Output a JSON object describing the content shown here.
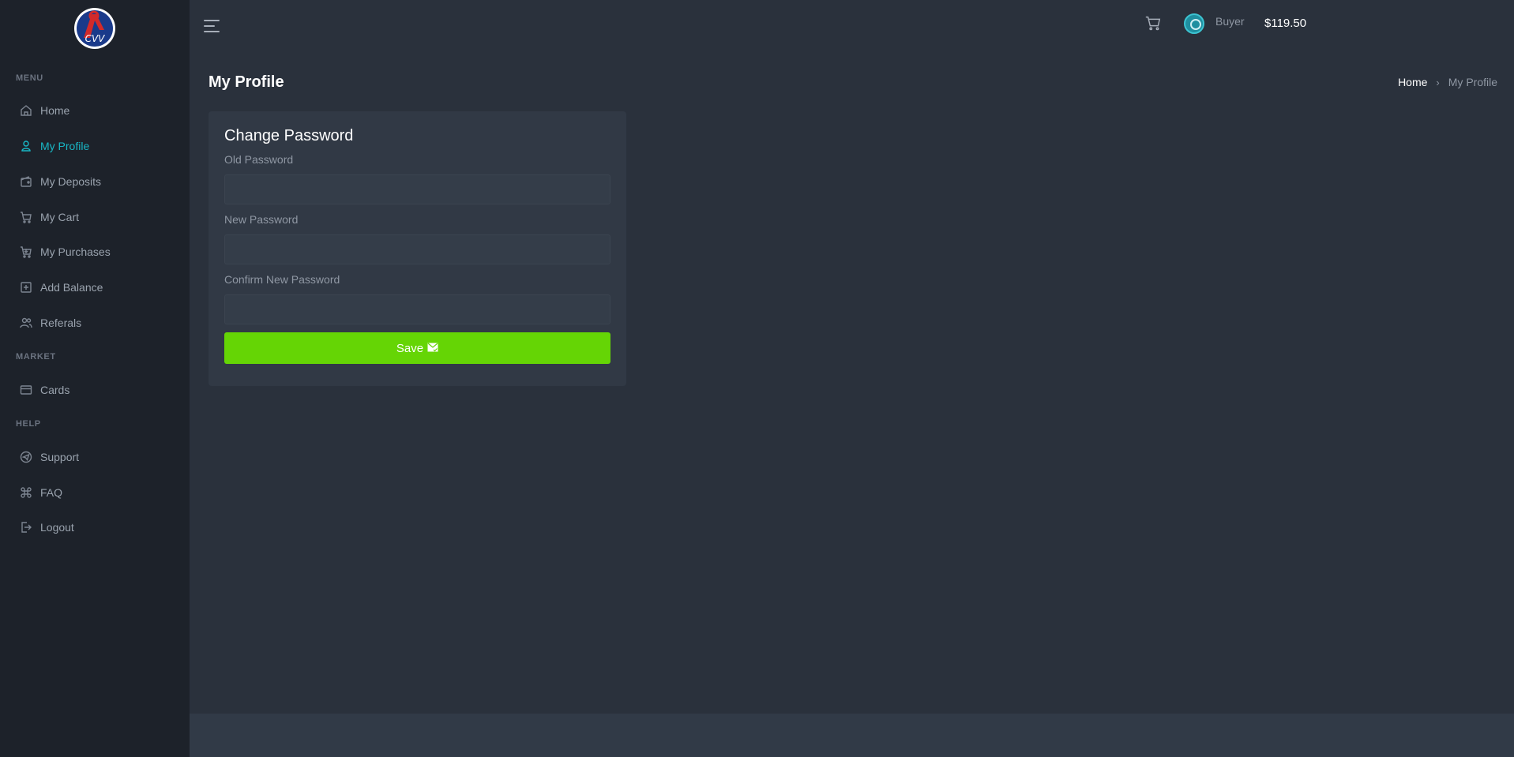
{
  "app": {
    "logo_text": "CVV"
  },
  "sidebar": {
    "sections": {
      "menu": "MENU",
      "market": "MARKET",
      "help": "HELP"
    },
    "items": [
      {
        "label": "Home",
        "icon": "home-icon"
      },
      {
        "label": "My Profile",
        "icon": "user-icon",
        "active": true
      },
      {
        "label": "My Deposits",
        "icon": "wallet-icon"
      },
      {
        "label": "My Cart",
        "icon": "cart-icon"
      },
      {
        "label": "My Purchases",
        "icon": "purchases-icon"
      },
      {
        "label": "Add Balance",
        "icon": "plus-square-icon"
      },
      {
        "label": "Referals",
        "icon": "users-icon"
      },
      {
        "label": "Cards",
        "icon": "card-icon"
      },
      {
        "label": "Support",
        "icon": "send-icon"
      },
      {
        "label": "FAQ",
        "icon": "command-icon"
      },
      {
        "label": "Logout",
        "icon": "logout-icon"
      }
    ]
  },
  "topbar": {
    "username": "Buyer",
    "balance": "$119.50"
  },
  "page": {
    "title": "My Profile",
    "breadcrumb": {
      "home": "Home",
      "separator": "›",
      "current": "My Profile"
    }
  },
  "form": {
    "title": "Change Password",
    "old_password_label": "Old Password",
    "old_password_value": "",
    "new_password_label": "New Password",
    "new_password_value": "",
    "confirm_password_label": "Confirm New Password",
    "confirm_password_value": "",
    "save_label": "Save"
  },
  "colors": {
    "accent": "#18b7c5",
    "save_button": "#65d505",
    "sidebar_bg": "#1d222a",
    "content_bg": "#2a313c"
  }
}
